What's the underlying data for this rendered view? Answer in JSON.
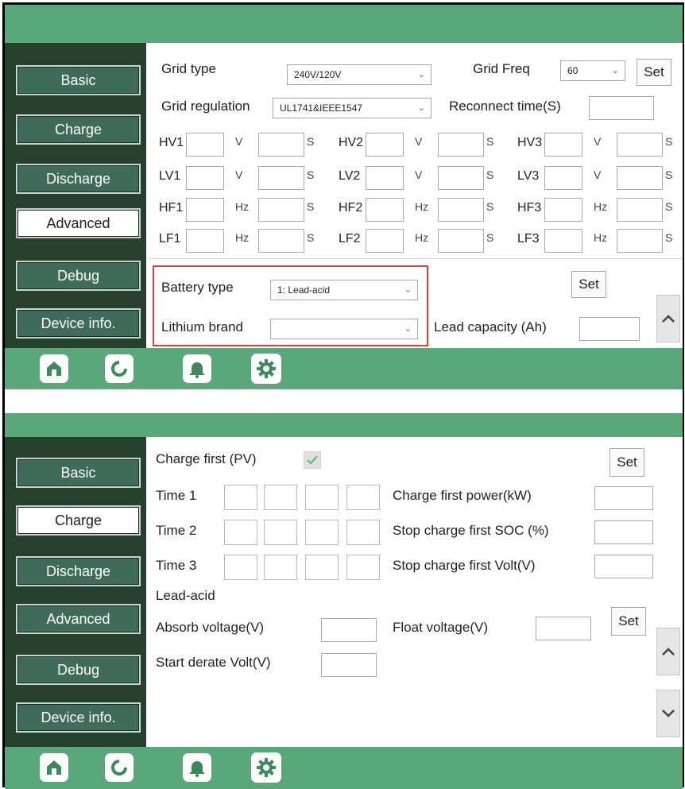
{
  "nav": {
    "basic": "Basic",
    "charge": "Charge",
    "discharge": "Discharge",
    "advanced": "Advanced",
    "debug": "Debug",
    "device_info": "Device info."
  },
  "advanced": {
    "grid_type_label": "Grid type",
    "grid_type_value": "240V/120V",
    "grid_freq_label": "Grid Freq",
    "grid_freq_value": "60",
    "set_label": "Set",
    "grid_regulation_label": "Grid regulation",
    "grid_regulation_value": "UL1741&IEEE1547",
    "reconnect_label": "Reconnect time(S)",
    "rows": [
      {
        "items": [
          {
            "name": "HV1",
            "unit": "V"
          },
          {
            "name": "HV2",
            "unit": "V"
          },
          {
            "name": "HV3",
            "unit": "V"
          }
        ]
      },
      {
        "items": [
          {
            "name": "LV1",
            "unit": "V"
          },
          {
            "name": "LV2",
            "unit": "V"
          },
          {
            "name": "LV3",
            "unit": "V"
          }
        ]
      },
      {
        "items": [
          {
            "name": "HF1",
            "unit": "Hz"
          },
          {
            "name": "HF2",
            "unit": "Hz"
          },
          {
            "name": "HF3",
            "unit": "Hz"
          }
        ]
      },
      {
        "items": [
          {
            "name": "LF1",
            "unit": "Hz"
          },
          {
            "name": "LF2",
            "unit": "Hz"
          },
          {
            "name": "LF3",
            "unit": "Hz"
          }
        ]
      }
    ],
    "seconds_unit": "S",
    "battery_type_label": "Battery  type",
    "battery_type_value": "1: Lead-acid",
    "battery_set_label": "Set",
    "lithium_brand_label": "Lithium  brand",
    "lithium_brand_value": "",
    "lead_capacity_label": "Lead capacity (Ah)"
  },
  "charge": {
    "charge_first_label": "Charge  first (PV)",
    "charge_first_checked": true,
    "set_label": "Set",
    "time1_label": "Time 1",
    "time2_label": "Time 2",
    "time3_label": "Time 3",
    "charge_first_power_label": "Charge  first  power(kW)",
    "stop_soc_label": "Stop charge first SOC (%)",
    "stop_volt_label": "Stop charge first Volt(V)",
    "lead_acid_label": "Lead-acid",
    "absorb_label": "Absorb  voltage(V)",
    "float_label": "Float  voltage(V)",
    "float_set_label": "Set",
    "start_derate_label": "Start derate Volt(V)"
  },
  "icons": {
    "home": "home-icon",
    "chart": "pie-chart-icon",
    "bell": "bell-icon",
    "gear": "gear-icon"
  },
  "colors": {
    "accent": "#5aa87a",
    "sidebar": "#26402e",
    "nav_button": "#3e6b5a",
    "highlight": "#e23b3b"
  }
}
